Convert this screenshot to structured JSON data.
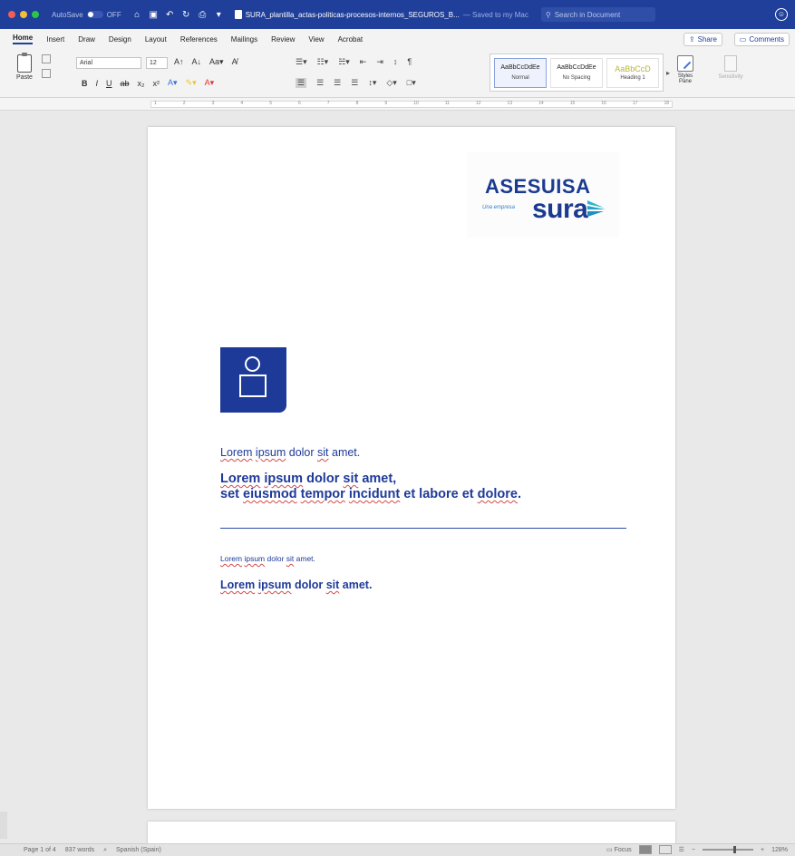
{
  "titlebar": {
    "autosave": "AutoSave",
    "autosave_state": "OFF",
    "doc_title": "SURA_plantilla_actas-politicas-procesos-internos_SEGUROS_B...",
    "saved": "— Saved to my Mac",
    "search_placeholder": "Search in Document",
    "colors": {
      "bar": "#1f3f9a"
    }
  },
  "tabs": [
    "Home",
    "Insert",
    "Draw",
    "Design",
    "Layout",
    "References",
    "Mailings",
    "Review",
    "View",
    "Acrobat"
  ],
  "share": "Share",
  "comments": "Comments",
  "ribbon": {
    "paste": "Paste",
    "font": "Arial",
    "size": "12",
    "styles": [
      {
        "sample": "AaBbCcDdEe",
        "name": "Normal"
      },
      {
        "sample": "AaBbCcDdEe",
        "name": "No Spacing"
      },
      {
        "sample": "AaBbCcD",
        "name": "Heading 1"
      }
    ],
    "styles_pane": "Styles Pane",
    "sensitivity": "Sensitivity"
  },
  "document": {
    "logo_line1": "ASESUISA",
    "logo_tagline": "Una empresa",
    "logo_line2": "sura",
    "line1": "Lorem ipsum dolor sit amet.",
    "line2a": "Lorem ipsum dolor sit amet,",
    "line2b": "set eiusmod tempor incidunt et labore et dolore.",
    "line3": "Lorem ipsum dolor sit amet.",
    "line4": "Lorem ipsum dolor sit amet.",
    "text_color": "#1e3a98"
  },
  "status": {
    "page": "Page 1 of 4",
    "words": "837 words",
    "language": "Spanish (Spain)",
    "focus": "Focus",
    "zoom": "128%"
  }
}
